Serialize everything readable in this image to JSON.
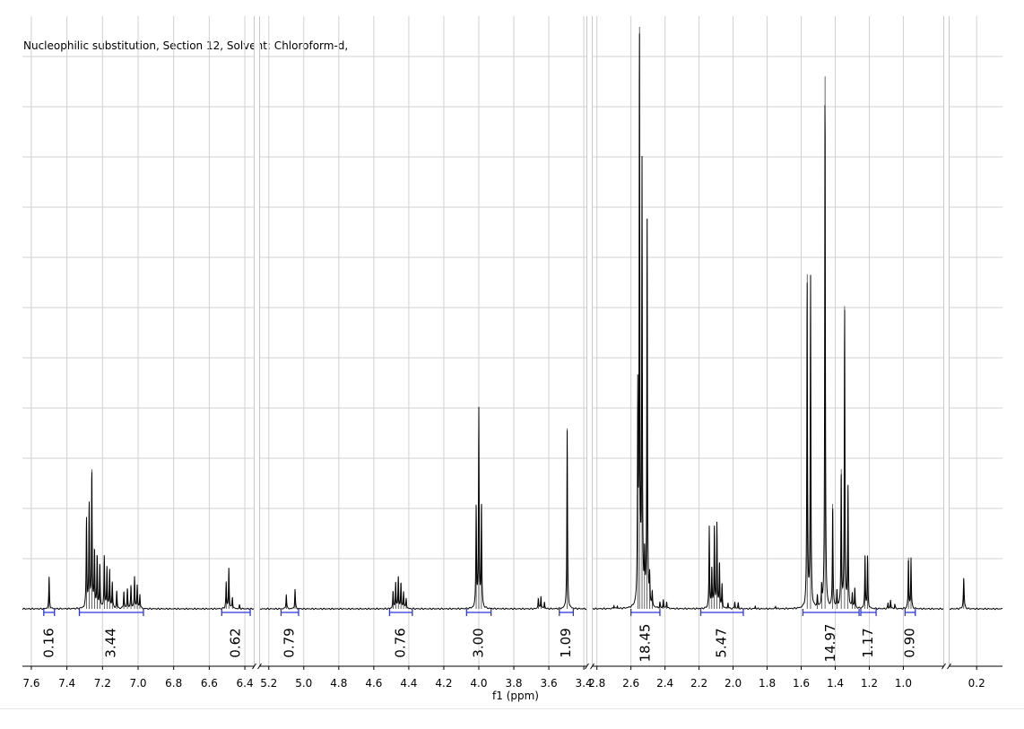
{
  "chart_data": {
    "type": "line",
    "title": "Nucleophilic substitution, Section 12, Solvent: Chloroform-d,",
    "xlabel": "f1 (ppm)",
    "ylabel": "",
    "x_reversed": true,
    "grid": true,
    "ylim": [
      0,
      1.0
    ],
    "segments": [
      {
        "xlim": [
          7.65,
          6.35
        ],
        "ticks": [
          "7.6",
          "7.4",
          "7.2",
          "7.0",
          "6.8",
          "6.6",
          "6.4"
        ]
      },
      {
        "xlim": [
          5.25,
          3.38
        ],
        "ticks": [
          "5.2",
          "5.0",
          "4.8",
          "4.6",
          "4.4",
          "4.2",
          "4.0",
          "3.8",
          "3.6",
          "3.4"
        ]
      },
      {
        "xlim": [
          2.83,
          0.76
        ],
        "ticks": [
          "2.8",
          "2.6",
          "2.4",
          "2.2",
          "2.0",
          "1.8",
          "1.6",
          "1.4",
          "1.2",
          "1.0"
        ]
      },
      {
        "xlim": [
          0.33,
          0.08
        ],
        "ticks": [
          "0.2"
        ]
      }
    ],
    "peaks": [
      {
        "x": 7.5,
        "h": 0.054
      },
      {
        "x": 7.29,
        "h": 0.155
      },
      {
        "x": 7.275,
        "h": 0.18
      },
      {
        "x": 7.26,
        "h": 0.24
      },
      {
        "x": 7.245,
        "h": 0.1
      },
      {
        "x": 7.23,
        "h": 0.09
      },
      {
        "x": 7.215,
        "h": 0.075
      },
      {
        "x": 7.19,
        "h": 0.09
      },
      {
        "x": 7.175,
        "h": 0.07
      },
      {
        "x": 7.16,
        "h": 0.065
      },
      {
        "x": 7.145,
        "h": 0.045
      },
      {
        "x": 7.12,
        "h": 0.03
      },
      {
        "x": 7.08,
        "h": 0.03
      },
      {
        "x": 7.06,
        "h": 0.035
      },
      {
        "x": 7.04,
        "h": 0.04
      },
      {
        "x": 7.02,
        "h": 0.055
      },
      {
        "x": 7.005,
        "h": 0.04
      },
      {
        "x": 6.99,
        "h": 0.025
      },
      {
        "x": 6.505,
        "h": 0.045
      },
      {
        "x": 6.49,
        "h": 0.07
      },
      {
        "x": 6.47,
        "h": 0.02
      },
      {
        "x": 6.43,
        "h": 0.006
      },
      {
        "x": 5.1,
        "h": 0.025
      },
      {
        "x": 5.05,
        "h": 0.034
      },
      {
        "x": 4.49,
        "h": 0.03
      },
      {
        "x": 4.475,
        "h": 0.045
      },
      {
        "x": 4.46,
        "h": 0.055
      },
      {
        "x": 4.445,
        "h": 0.045
      },
      {
        "x": 4.43,
        "h": 0.03
      },
      {
        "x": 4.415,
        "h": 0.018
      },
      {
        "x": 4.015,
        "h": 0.175
      },
      {
        "x": 4.0,
        "h": 0.34
      },
      {
        "x": 3.985,
        "h": 0.18
      },
      {
        "x": 3.66,
        "h": 0.018
      },
      {
        "x": 3.645,
        "h": 0.022
      },
      {
        "x": 3.625,
        "h": 0.012
      },
      {
        "x": 3.495,
        "h": 0.31
      },
      {
        "x": 2.7,
        "h": 0.006
      },
      {
        "x": 2.68,
        "h": 0.004
      },
      {
        "x": 2.56,
        "h": 0.35
      },
      {
        "x": 2.55,
        "h": 1.0
      },
      {
        "x": 2.535,
        "h": 0.75
      },
      {
        "x": 2.52,
        "h": 0.08
      },
      {
        "x": 2.505,
        "h": 0.67
      },
      {
        "x": 2.49,
        "h": 0.05
      },
      {
        "x": 2.475,
        "h": 0.025
      },
      {
        "x": 2.43,
        "h": 0.01
      },
      {
        "x": 2.41,
        "h": 0.015
      },
      {
        "x": 2.39,
        "h": 0.012
      },
      {
        "x": 2.14,
        "h": 0.14
      },
      {
        "x": 2.125,
        "h": 0.07
      },
      {
        "x": 2.11,
        "h": 0.14
      },
      {
        "x": 2.095,
        "h": 0.145
      },
      {
        "x": 2.08,
        "h": 0.08
      },
      {
        "x": 2.065,
        "h": 0.04
      },
      {
        "x": 2.03,
        "h": 0.01
      },
      {
        "x": 1.99,
        "h": 0.012
      },
      {
        "x": 1.97,
        "h": 0.01
      },
      {
        "x": 1.87,
        "h": 0.004
      },
      {
        "x": 1.75,
        "h": 0.004
      },
      {
        "x": 1.565,
        "h": 0.575
      },
      {
        "x": 1.545,
        "h": 0.57
      },
      {
        "x": 1.505,
        "h": 0.02
      },
      {
        "x": 1.48,
        "h": 0.035
      },
      {
        "x": 1.46,
        "h": 0.915
      },
      {
        "x": 1.415,
        "h": 0.18
      },
      {
        "x": 1.39,
        "h": 0.03
      },
      {
        "x": 1.365,
        "h": 0.24
      },
      {
        "x": 1.345,
        "h": 0.52
      },
      {
        "x": 1.325,
        "h": 0.205
      },
      {
        "x": 1.3,
        "h": 0.025
      },
      {
        "x": 1.285,
        "h": 0.035
      },
      {
        "x": 1.225,
        "h": 0.09
      },
      {
        "x": 1.21,
        "h": 0.09
      },
      {
        "x": 1.09,
        "h": 0.01
      },
      {
        "x": 1.075,
        "h": 0.015
      },
      {
        "x": 1.05,
        "h": 0.008
      },
      {
        "x": 0.97,
        "h": 0.088
      },
      {
        "x": 0.955,
        "h": 0.087
      },
      {
        "x": 0.26,
        "h": 0.053
      }
    ],
    "integrals": [
      {
        "from": 7.53,
        "to": 7.47,
        "value": "0.16"
      },
      {
        "from": 7.33,
        "to": 6.97,
        "value": "3.44"
      },
      {
        "from": 6.53,
        "to": 6.37,
        "value": "0.62"
      },
      {
        "from": 5.13,
        "to": 5.03,
        "value": "0.79"
      },
      {
        "from": 4.51,
        "to": 4.38,
        "value": "0.76"
      },
      {
        "from": 4.07,
        "to": 3.93,
        "value": "3.00"
      },
      {
        "from": 3.54,
        "to": 3.46,
        "value": "1.09"
      },
      {
        "from": 2.6,
        "to": 2.43,
        "value": "18.45"
      },
      {
        "from": 2.19,
        "to": 1.94,
        "value": "5.47"
      },
      {
        "from": 1.59,
        "to": 1.26,
        "value": "14.97"
      },
      {
        "from": 1.25,
        "to": 1.16,
        "value": "1.17"
      },
      {
        "from": 0.99,
        "to": 0.93,
        "value": "0.90"
      }
    ]
  }
}
